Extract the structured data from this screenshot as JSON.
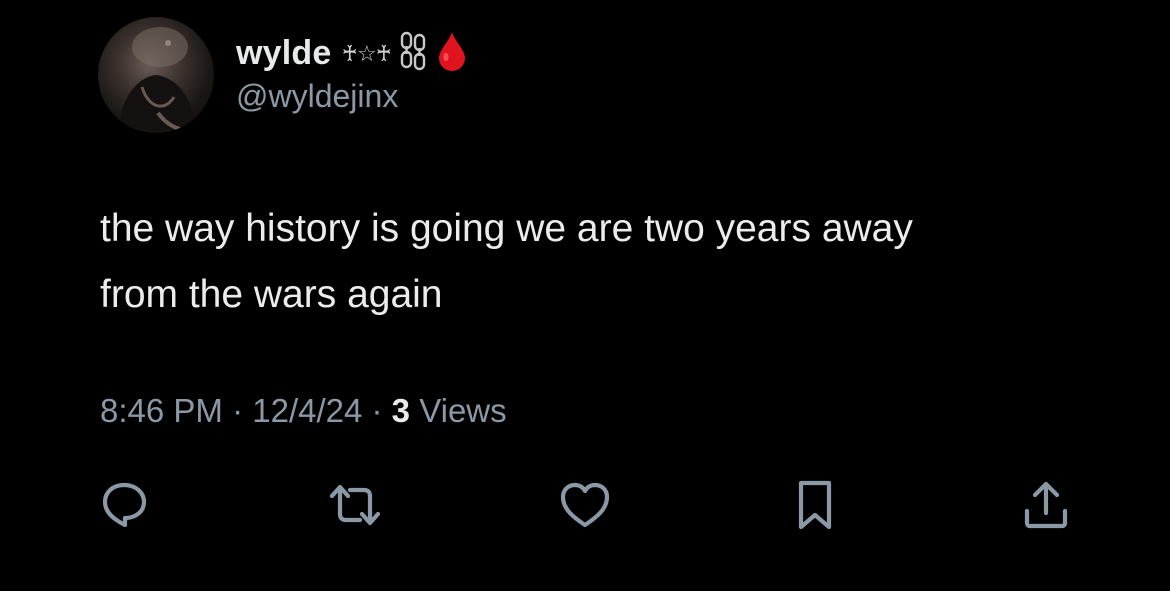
{
  "user": {
    "display_name": "wylde",
    "name_glyphs": "♰☆♰",
    "chain_icon": "chain-icon",
    "drop_icon": "blood-drop-icon",
    "handle": "@wyldejinx"
  },
  "tweet": {
    "text_line1": "the way history is going we are two years away",
    "text_line2": "from the wars again"
  },
  "meta": {
    "time": "8:46 PM",
    "separator": " · ",
    "date": "12/4/24",
    "views_count": "3",
    "views_label": " Views"
  },
  "actions": [
    "reply-icon",
    "retweet-icon",
    "like-icon",
    "bookmark-icon",
    "share-icon"
  ],
  "colors": {
    "background": "#000000",
    "primary_text": "#e7e9ea",
    "secondary_text": "#8b98a5",
    "drop_red": "#e0141e"
  }
}
